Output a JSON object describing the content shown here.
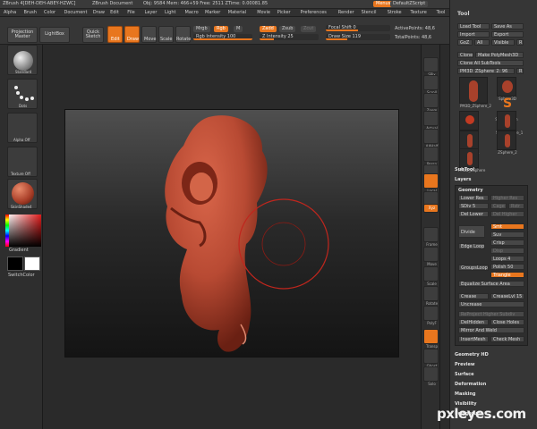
{
  "app": {
    "title_left": "ZBrush 4[DEH-DEH-ABEY-HZWC]",
    "document": "ZBrush Document",
    "stats": "Obj: 9584 Mem: 466+59 Free: 2511 ZTime: 0.00081.85",
    "menus_btn": "Menus",
    "script": "DefaultZScript"
  },
  "menubar": {
    "items": [
      "Alpha",
      "Brush",
      "Color",
      "Document",
      "Draw",
      "Edit",
      "File",
      "Layer",
      "Light",
      "Macro",
      "Marker",
      "Material",
      "Movie",
      "Picker",
      "Preferences",
      "Render",
      "Stencil",
      "Stroke",
      "Texture",
      "Tool",
      "Transform",
      "Zoom",
      "Zplugin",
      "Zscript"
    ]
  },
  "topshelf": {
    "projection_master": "Projection Master",
    "lightbox": "LightBox",
    "quick_sketch": "Quick Sketch",
    "edit": "Edit",
    "draw": "Draw",
    "move": "Move",
    "scale": "Scale",
    "rotate": "Rotate",
    "mrgb": "Mrgb",
    "rgb": "Rgb",
    "m": "M",
    "zadd": "Zadd",
    "zsub": "Zsub",
    "zcut": "Zcut",
    "rgb_intensity": "Rgb Intensity 100",
    "z_intensity": "Z Intensity 25",
    "focal_shift": "Focal Shift 0",
    "draw_size": "Draw Size 119",
    "active_points": "ActivePoints: 48,6",
    "total_points": "TotalPoints: 48,6"
  },
  "lefttray": {
    "brush_label": "Standard",
    "stroke_label": "Dots",
    "alpha_label": "Alpha Off",
    "texture_label": "Texture Off",
    "material_label": "SkinShade4",
    "gradient": "Gradient",
    "switch_color": "SwitchColor"
  },
  "rightshelf": {
    "buttons": [
      "SPix",
      "Scroll",
      "Zoom",
      "Actual",
      "AAHalf",
      "Persp",
      "Floor",
      "Local",
      "L.Sym",
      "Xyz",
      "Frame",
      "Move",
      "Scale",
      "Rotate",
      "PolyF",
      "Transp",
      "Ghost",
      "Solo"
    ]
  },
  "tool": {
    "title": "Tool",
    "load_tool": "Load Tool",
    "save_as": "Save As",
    "import": "Import",
    "export": "Export",
    "goz": "GoZ",
    "all": "All",
    "visible": "Visible",
    "r": "R",
    "clone": "Clone",
    "make_polymesh": "Make PolyMesh3D",
    "clone_all": "Clone All SubTools",
    "current": "PM3D_ZSphere_2: 96",
    "thumbs": [
      "PM3D_ZSphere_2",
      "Sphere3D",
      "SimpleBrush",
      "ZSphere",
      "Sks_ZSphere_1",
      "ZSphere_1",
      "ZSphere_2",
      "PM3D_ZSphere"
    ]
  },
  "sections": {
    "subtool": "SubTool",
    "layers": "Layers",
    "geometry": "Geometry",
    "geometry_hd": "Geometry HD",
    "preview": "Preview",
    "surface": "Surface",
    "deformation": "Deformation",
    "masking": "Masking",
    "visibility": "Visibility",
    "polygroups": "Polygroups"
  },
  "geometry": {
    "lower_res": "Lower Res",
    "higher_res": "Higher Res",
    "sdiv": "SDiv 5",
    "cage": "Cage",
    "rstr": "Rstr",
    "del_lower": "Del Lower",
    "del_higher": "Del Higher",
    "divide": "Divide",
    "smt": "Smt",
    "suv": "Suv",
    "edge_loop": "Edge Loop",
    "crisp": "Crisp",
    "disp": "Disp",
    "loops": "Loops 4",
    "polish": "Polish 50",
    "triangle": "Triangle",
    "group_loops": "GroupsLoops",
    "equalize": "Equalize Surface Area",
    "crease": "Crease",
    "crease_lvl": "CreaseLvl 15",
    "uncrease": "Uncrease",
    "reproject": "ReProject Higher Subdiv",
    "deldidden": "DelHidden",
    "close_holes": "Close Holes",
    "mirror_weld": "Mirror And Weld",
    "insert_mesh": "InsertMesh",
    "check_mesh": "Check Mesh"
  },
  "watermark": "pxleyes.com",
  "colors": {
    "accent": "#e8761e",
    "model": "#b84a33",
    "brush_circle": "#c0261d"
  }
}
